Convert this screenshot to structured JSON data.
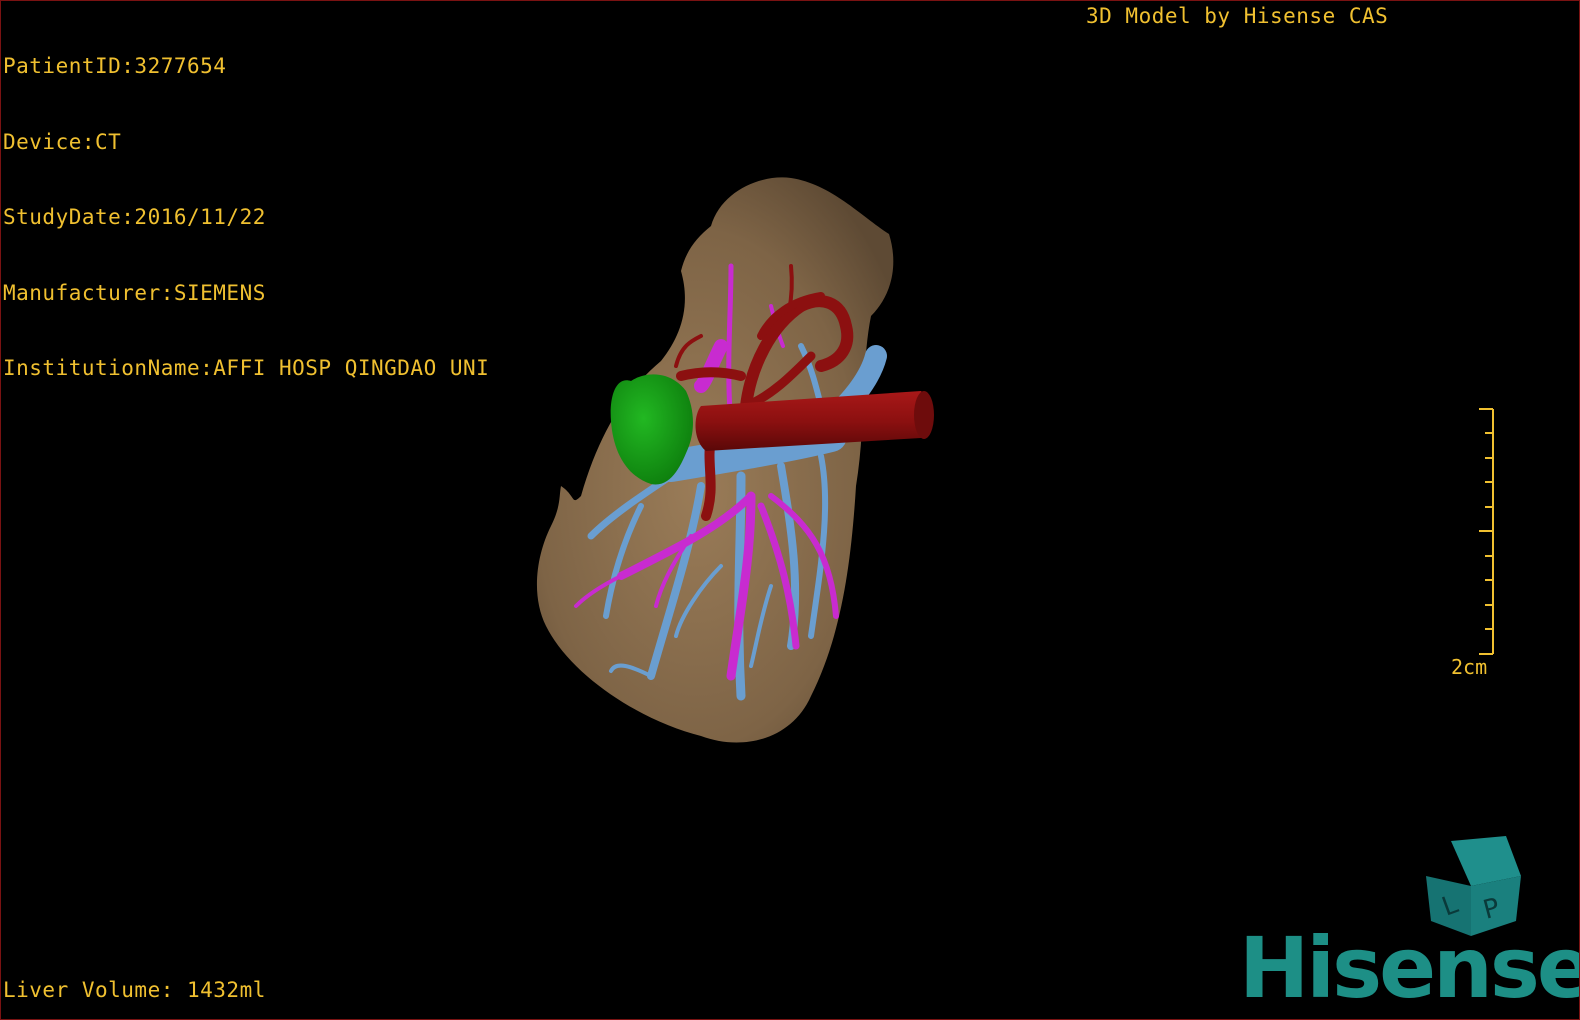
{
  "overlay": {
    "patient_id": "PatientID:3277654",
    "device": "Device:CT",
    "study_date": "StudyDate:2016/11/22",
    "manufacturer": "Manufacturer:SIEMENS",
    "institution": "InstitutionName:AFFI HOSP QINGDAO UNI",
    "model_credit": "3D Model by Hisense CAS",
    "liver_volume": "Liver Volume: 1432ml"
  },
  "scale": {
    "label": "2cm"
  },
  "orientation_cube": {
    "faces": [
      "L",
      "P"
    ]
  },
  "brand": {
    "name": "Hisense"
  },
  "colors": {
    "overlay_text": "#f0c030",
    "liver": "#8a6e4e",
    "hepatic_vein": "#6a9ed0",
    "portal_vein": "#c82bd0",
    "artery": "#8c1010",
    "gallbladder": "#149614",
    "brand": "#1d8f86"
  }
}
